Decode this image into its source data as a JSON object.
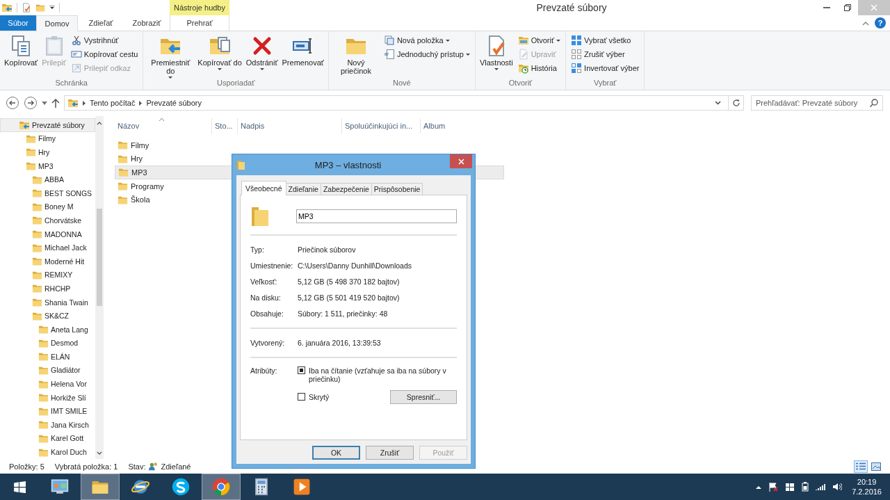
{
  "window": {
    "title": "Prevzaté súbory"
  },
  "ribbon": {
    "contextual_group": "Nástroje hudby",
    "help_button": "?",
    "tabs": [
      {
        "label": "Súbor",
        "kind": "file",
        "selected": false
      },
      {
        "label": "Domov",
        "kind": "tab",
        "selected": true
      },
      {
        "label": "Zdieľať",
        "kind": "tab",
        "selected": false
      },
      {
        "label": "Zobraziť",
        "kind": "tab",
        "selected": false
      },
      {
        "label": "Prehrať",
        "kind": "contextual",
        "selected": false
      }
    ],
    "groups": [
      {
        "label": "Schránka",
        "commands": [
          {
            "label": "Kopírovať",
            "kind": "large",
            "disabled": false,
            "dropdown": false
          },
          {
            "label": "Prilepiť",
            "kind": "large",
            "disabled": true,
            "dropdown": false
          },
          {
            "label": "Vystrihnúť",
            "kind": "small",
            "disabled": false,
            "dropdown": false
          },
          {
            "label": "Kopírovať cestu",
            "kind": "small",
            "disabled": false,
            "dropdown": false
          },
          {
            "label": "Prilepiť odkaz",
            "kind": "small",
            "disabled": true,
            "dropdown": false
          }
        ]
      },
      {
        "label": "Usporiadať",
        "commands": [
          {
            "label": "Premiestniť do",
            "kind": "large",
            "disabled": false,
            "dropdown": true
          },
          {
            "label": "Kopírovať do",
            "kind": "large",
            "disabled": false,
            "dropdown": true
          },
          {
            "label": "Odstrániť",
            "kind": "large",
            "disabled": false,
            "dropdown": true
          },
          {
            "label": "Premenovať",
            "kind": "large",
            "disabled": false,
            "dropdown": false
          }
        ]
      },
      {
        "label": "Nové",
        "commands": [
          {
            "label": "Nový priečinok",
            "kind": "large",
            "disabled": false,
            "dropdown": false
          },
          {
            "label": "Nová položka",
            "kind": "small",
            "disabled": false,
            "dropdown": true
          },
          {
            "label": "Jednoduchý prístup",
            "kind": "small",
            "disabled": false,
            "dropdown": true
          }
        ]
      },
      {
        "label": "Otvoriť",
        "commands": [
          {
            "label": "Vlastnosti",
            "kind": "large",
            "disabled": false,
            "dropdown": true
          },
          {
            "label": "Otvoriť",
            "kind": "small",
            "disabled": false,
            "dropdown": true
          },
          {
            "label": "Upraviť",
            "kind": "small",
            "disabled": true,
            "dropdown": false
          },
          {
            "label": "História",
            "kind": "small",
            "disabled": false,
            "dropdown": false
          }
        ]
      },
      {
        "label": "Vybrať",
        "commands": [
          {
            "label": "Vybrať všetko",
            "kind": "small",
            "disabled": false,
            "dropdown": false
          },
          {
            "label": "Zrušiť výber",
            "kind": "small",
            "disabled": false,
            "dropdown": false
          },
          {
            "label": "Invertovať výber",
            "kind": "small",
            "disabled": false,
            "dropdown": false
          }
        ]
      }
    ]
  },
  "address": {
    "path": [
      "Tento počítač",
      "Prevzaté súbory"
    ],
    "search_placeholder": "Prehľadávať: Prevzaté súbory"
  },
  "tree": [
    {
      "label": "Prevzaté súbory",
      "selected": true,
      "children": [
        {
          "label": "Filmy",
          "selected": false
        },
        {
          "label": "Hry",
          "selected": false
        },
        {
          "label": "MP3",
          "selected": false,
          "children": [
            {
              "label": "ABBA",
              "selected": false
            },
            {
              "label": "BEST SONGS",
              "selected": false
            },
            {
              "label": "Boney M",
              "selected": false
            },
            {
              "label": "Chorvátske",
              "selected": false
            },
            {
              "label": "MADONNA",
              "selected": false
            },
            {
              "label": "Michael Jack",
              "selected": false
            },
            {
              "label": "Moderné Hit",
              "selected": false
            },
            {
              "label": "REMIXY",
              "selected": false
            },
            {
              "label": "RHCHP",
              "selected": false
            },
            {
              "label": "Shania Twain",
              "selected": false
            },
            {
              "label": "SK&CZ",
              "selected": false,
              "children": [
                {
                  "label": "Aneta Lang",
                  "selected": false
                },
                {
                  "label": "Desmod",
                  "selected": false
                },
                {
                  "label": "ELÁN",
                  "selected": false
                },
                {
                  "label": "Gladiátor",
                  "selected": false
                },
                {
                  "label": "Helena Vor",
                  "selected": false
                },
                {
                  "label": "Horkiže Slí",
                  "selected": false
                },
                {
                  "label": "IMT SMILE",
                  "selected": false
                },
                {
                  "label": "Jana Kirsch",
                  "selected": false
                },
                {
                  "label": "Karel Gott",
                  "selected": false
                },
                {
                  "label": "Karol Duch",
                  "selected": false
                }
              ]
            }
          ]
        }
      ]
    }
  ],
  "columns": [
    "Názov",
    "Sto...",
    "Nadpis",
    "Spoluúčinkujúci in...",
    "Album"
  ],
  "files": [
    {
      "name": "Filmy",
      "selected": false
    },
    {
      "name": "Hry",
      "selected": false
    },
    {
      "name": "MP3",
      "selected": true
    },
    {
      "name": "Programy",
      "selected": false
    },
    {
      "name": "Škola",
      "selected": false
    }
  ],
  "status_bar": {
    "items": [
      "Položky: 5",
      "Vybratá položka: 1"
    ],
    "state_label": "Stav:",
    "state_value": "Zdieľané",
    "views": [
      {
        "kind": "details",
        "selected": true
      },
      {
        "kind": "large-icons",
        "selected": false
      }
    ]
  },
  "dialog": {
    "title": "MP3 – vlastnosti",
    "tabs": [
      {
        "label": "Všeobecné",
        "selected": true
      },
      {
        "label": "Zdieľanie",
        "selected": false
      },
      {
        "label": "Zabezpečenie",
        "selected": false
      },
      {
        "label": "Prispôsobenie",
        "selected": false
      }
    ],
    "name": "MP3",
    "properties": [
      {
        "label": "Typ:",
        "value": "Priečinok súborov"
      },
      {
        "label": "Umiestnenie:",
        "value": "C:\\Users\\Danny Dunhill\\Downloads"
      },
      {
        "label": "Veľkosť:",
        "value": "5,12 GB (5 498 370 182 bajtov)"
      },
      {
        "label": "Na disku:",
        "value": "5,12 GB (5 501 419 520 bajtov)"
      },
      {
        "label": "Obsahuje:",
        "value": "Súbory: 1 511, priečinky: 48"
      }
    ],
    "created": {
      "label": "Vytvorený:",
      "value": "6. januára 2016, 13:39:53"
    },
    "attributes_label": "Atribúty:",
    "attributes": [
      {
        "label": "Iba na čítanie (vzťahuje sa iba na súbory v priečinku)",
        "checked": true
      },
      {
        "label": "Skrytý",
        "checked": false
      }
    ],
    "advanced_button": "Spresniť...",
    "buttons": [
      {
        "label": "OK",
        "default": true,
        "disabled": false
      },
      {
        "label": "Zrušiť",
        "default": false,
        "disabled": false
      },
      {
        "label": "Použiť",
        "default": false,
        "disabled": true
      }
    ]
  },
  "taskbar": {
    "buttons": [
      {
        "kind": "start",
        "selected": false
      },
      {
        "kind": "control-panel",
        "selected": false
      },
      {
        "kind": "file-explorer",
        "selected": true
      },
      {
        "kind": "internet-explorer",
        "selected": false
      },
      {
        "kind": "skype",
        "selected": false
      },
      {
        "kind": "chrome",
        "selected": true
      },
      {
        "kind": "calculator",
        "selected": false
      },
      {
        "kind": "media-player",
        "selected": false
      }
    ],
    "time": "20:19",
    "date": "7.2.2016"
  }
}
